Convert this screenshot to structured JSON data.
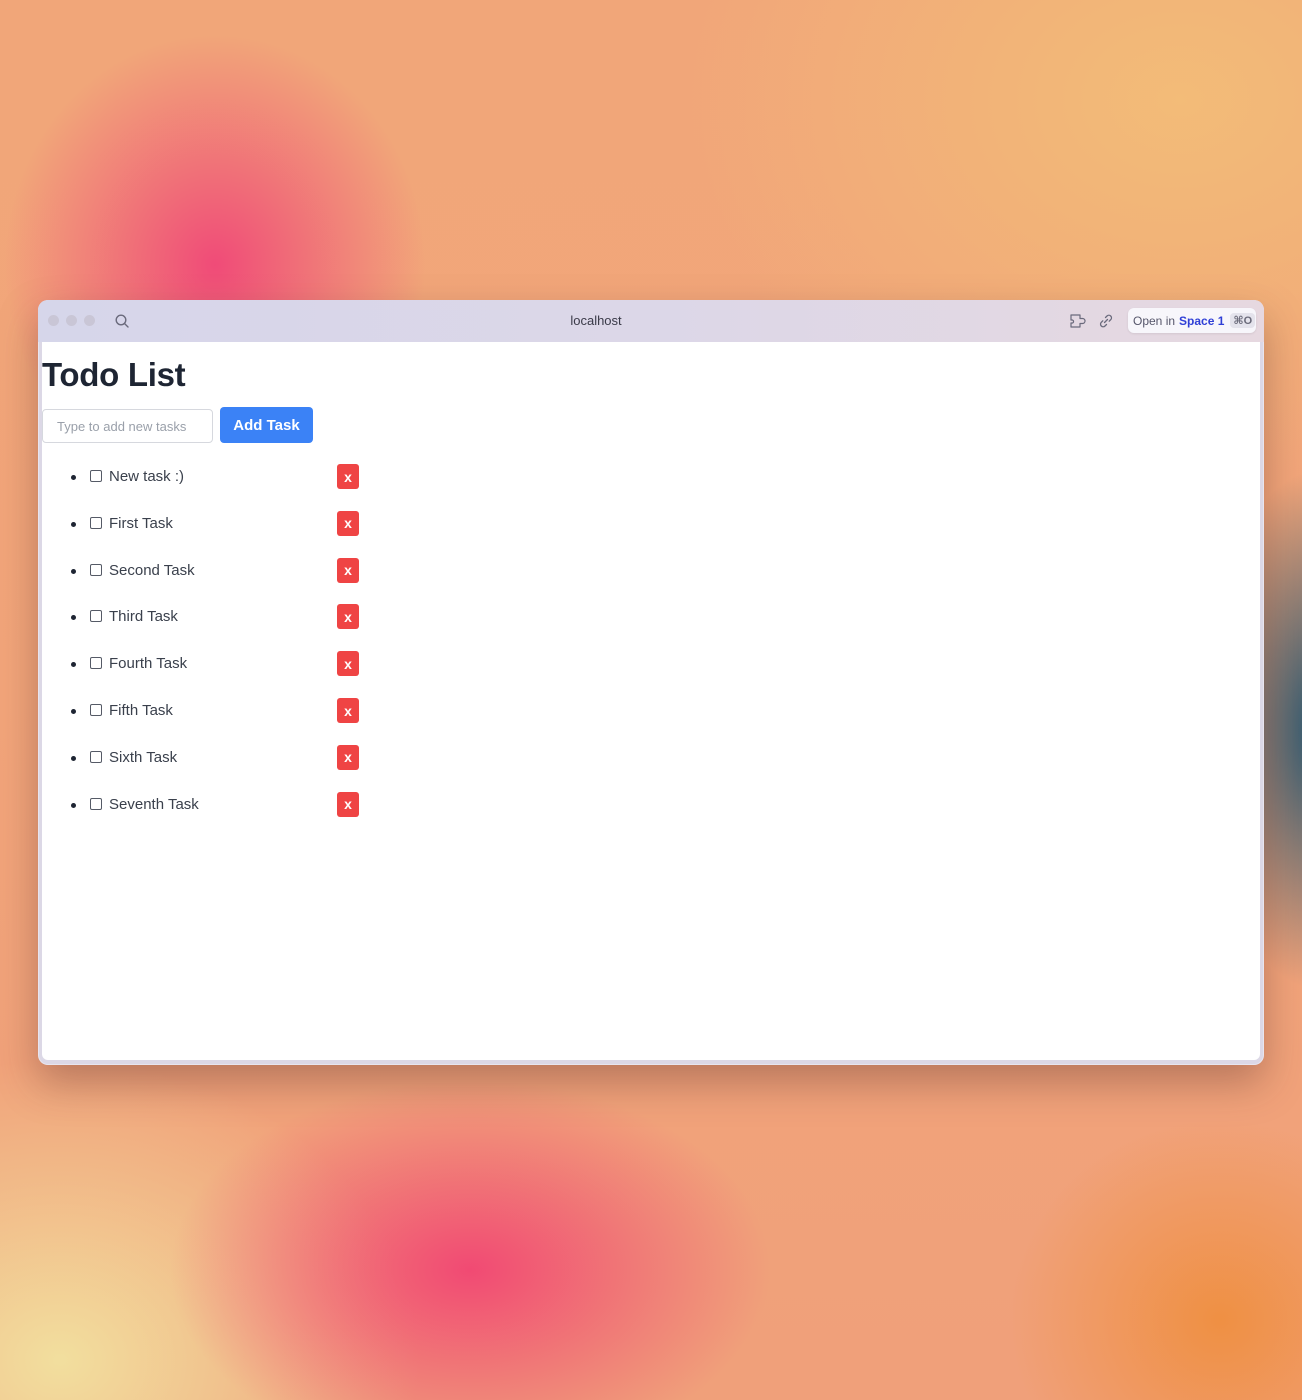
{
  "browser": {
    "url": "localhost",
    "open_in_prefix": "Open in",
    "open_in_space": "Space 1",
    "open_in_shortcut": "⌘O"
  },
  "page": {
    "title": "Todo List",
    "input": {
      "placeholder": "Type to add new tasks",
      "value": ""
    },
    "add_button_label": "Add Task",
    "tasks": [
      {
        "label": "New task :)",
        "checked": false,
        "delete_label": "x"
      },
      {
        "label": "First Task",
        "checked": false,
        "delete_label": "x"
      },
      {
        "label": "Second Task",
        "checked": false,
        "delete_label": "x"
      },
      {
        "label": "Third Task",
        "checked": false,
        "delete_label": "x"
      },
      {
        "label": "Fourth Task",
        "checked": false,
        "delete_label": "x"
      },
      {
        "label": "Fifth Task",
        "checked": false,
        "delete_label": "x"
      },
      {
        "label": "Sixth Task",
        "checked": false,
        "delete_label": "x"
      },
      {
        "label": "Seventh Task",
        "checked": false,
        "delete_label": "x"
      }
    ]
  },
  "colors": {
    "primary_button": "#3b82f6",
    "delete_button": "#ef4444",
    "title_text": "#1e2533"
  }
}
